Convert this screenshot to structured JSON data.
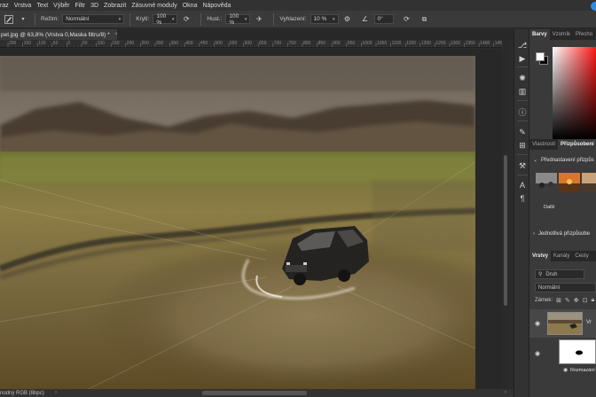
{
  "menubar": {
    "items": [
      "raz",
      "Vrstva",
      "Text",
      "Výběr",
      "Filtr",
      "3D",
      "Zobrazit",
      "Zásuvné moduly",
      "Okna",
      "Nápověda"
    ]
  },
  "options": {
    "mode_label": "Režim:",
    "mode_value": "Normální",
    "opacity_label": "Krytí:",
    "opacity_value": "100 %",
    "flow_label": "Hust.:",
    "flow_value": "100 %",
    "smoothing_label": "Vyhlazení:",
    "smoothing_value": "10 %",
    "angle_value": "0°"
  },
  "document": {
    "tab_title": "pet.jpg @ 63,8% (Vrstva 0,Maska filtru/8) *",
    "close_glyph": "×"
  },
  "ruler": {
    "ticks": [
      "200",
      "150",
      "100",
      "50",
      "0",
      "50",
      "100",
      "150",
      "200",
      "250",
      "300",
      "350",
      "400",
      "450",
      "500",
      "550",
      "600",
      "650",
      "700",
      "750",
      "800",
      "850",
      "900",
      "950",
      "1000",
      "1050",
      "1100",
      "1150",
      "1200",
      "1250",
      "1300",
      "1350",
      "1400",
      "1450"
    ]
  },
  "status": {
    "text": "nodný RGB (8bpc)"
  },
  "panels": {
    "color_tabs": [
      "Barvy",
      "Vzorník",
      "Přecho"
    ],
    "props_tabs": [
      "Vlastnosti",
      "Přizpůsobení"
    ],
    "presets_header": "Přednastavení přizpůs",
    "more_label": "Další",
    "individual_header": "Jednotlivá přizpůsobe",
    "layers_tabs": [
      "Vrstvy",
      "Kanály",
      "Cesty"
    ],
    "search_value": "Druh",
    "blend_mode": "Normální",
    "lock_label": "Zámek:",
    "layer_name": "Vr",
    "filter_mask_name": "Rozmazání",
    "fg_color": "#ffffff",
    "bg_color": "#000000"
  }
}
